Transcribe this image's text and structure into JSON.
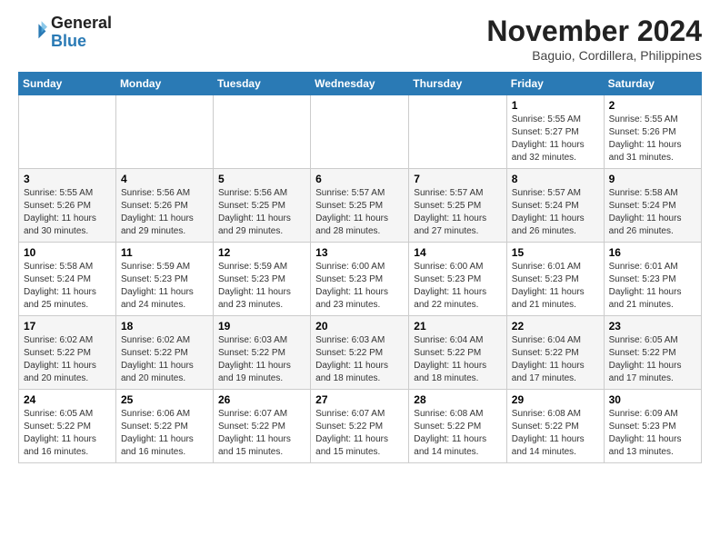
{
  "header": {
    "logo_line1": "General",
    "logo_line2": "Blue",
    "month": "November 2024",
    "location": "Baguio, Cordillera, Philippines"
  },
  "weekdays": [
    "Sunday",
    "Monday",
    "Tuesday",
    "Wednesday",
    "Thursday",
    "Friday",
    "Saturday"
  ],
  "weeks": [
    [
      {
        "day": "",
        "info": ""
      },
      {
        "day": "",
        "info": ""
      },
      {
        "day": "",
        "info": ""
      },
      {
        "day": "",
        "info": ""
      },
      {
        "day": "",
        "info": ""
      },
      {
        "day": "1",
        "info": "Sunrise: 5:55 AM\nSunset: 5:27 PM\nDaylight: 11 hours and 32 minutes."
      },
      {
        "day": "2",
        "info": "Sunrise: 5:55 AM\nSunset: 5:26 PM\nDaylight: 11 hours and 31 minutes."
      }
    ],
    [
      {
        "day": "3",
        "info": "Sunrise: 5:55 AM\nSunset: 5:26 PM\nDaylight: 11 hours and 30 minutes."
      },
      {
        "day": "4",
        "info": "Sunrise: 5:56 AM\nSunset: 5:26 PM\nDaylight: 11 hours and 29 minutes."
      },
      {
        "day": "5",
        "info": "Sunrise: 5:56 AM\nSunset: 5:25 PM\nDaylight: 11 hours and 29 minutes."
      },
      {
        "day": "6",
        "info": "Sunrise: 5:57 AM\nSunset: 5:25 PM\nDaylight: 11 hours and 28 minutes."
      },
      {
        "day": "7",
        "info": "Sunrise: 5:57 AM\nSunset: 5:25 PM\nDaylight: 11 hours and 27 minutes."
      },
      {
        "day": "8",
        "info": "Sunrise: 5:57 AM\nSunset: 5:24 PM\nDaylight: 11 hours and 26 minutes."
      },
      {
        "day": "9",
        "info": "Sunrise: 5:58 AM\nSunset: 5:24 PM\nDaylight: 11 hours and 26 minutes."
      }
    ],
    [
      {
        "day": "10",
        "info": "Sunrise: 5:58 AM\nSunset: 5:24 PM\nDaylight: 11 hours and 25 minutes."
      },
      {
        "day": "11",
        "info": "Sunrise: 5:59 AM\nSunset: 5:23 PM\nDaylight: 11 hours and 24 minutes."
      },
      {
        "day": "12",
        "info": "Sunrise: 5:59 AM\nSunset: 5:23 PM\nDaylight: 11 hours and 23 minutes."
      },
      {
        "day": "13",
        "info": "Sunrise: 6:00 AM\nSunset: 5:23 PM\nDaylight: 11 hours and 23 minutes."
      },
      {
        "day": "14",
        "info": "Sunrise: 6:00 AM\nSunset: 5:23 PM\nDaylight: 11 hours and 22 minutes."
      },
      {
        "day": "15",
        "info": "Sunrise: 6:01 AM\nSunset: 5:23 PM\nDaylight: 11 hours and 21 minutes."
      },
      {
        "day": "16",
        "info": "Sunrise: 6:01 AM\nSunset: 5:23 PM\nDaylight: 11 hours and 21 minutes."
      }
    ],
    [
      {
        "day": "17",
        "info": "Sunrise: 6:02 AM\nSunset: 5:22 PM\nDaylight: 11 hours and 20 minutes."
      },
      {
        "day": "18",
        "info": "Sunrise: 6:02 AM\nSunset: 5:22 PM\nDaylight: 11 hours and 20 minutes."
      },
      {
        "day": "19",
        "info": "Sunrise: 6:03 AM\nSunset: 5:22 PM\nDaylight: 11 hours and 19 minutes."
      },
      {
        "day": "20",
        "info": "Sunrise: 6:03 AM\nSunset: 5:22 PM\nDaylight: 11 hours and 18 minutes."
      },
      {
        "day": "21",
        "info": "Sunrise: 6:04 AM\nSunset: 5:22 PM\nDaylight: 11 hours and 18 minutes."
      },
      {
        "day": "22",
        "info": "Sunrise: 6:04 AM\nSunset: 5:22 PM\nDaylight: 11 hours and 17 minutes."
      },
      {
        "day": "23",
        "info": "Sunrise: 6:05 AM\nSunset: 5:22 PM\nDaylight: 11 hours and 17 minutes."
      }
    ],
    [
      {
        "day": "24",
        "info": "Sunrise: 6:05 AM\nSunset: 5:22 PM\nDaylight: 11 hours and 16 minutes."
      },
      {
        "day": "25",
        "info": "Sunrise: 6:06 AM\nSunset: 5:22 PM\nDaylight: 11 hours and 16 minutes."
      },
      {
        "day": "26",
        "info": "Sunrise: 6:07 AM\nSunset: 5:22 PM\nDaylight: 11 hours and 15 minutes."
      },
      {
        "day": "27",
        "info": "Sunrise: 6:07 AM\nSunset: 5:22 PM\nDaylight: 11 hours and 15 minutes."
      },
      {
        "day": "28",
        "info": "Sunrise: 6:08 AM\nSunset: 5:22 PM\nDaylight: 11 hours and 14 minutes."
      },
      {
        "day": "29",
        "info": "Sunrise: 6:08 AM\nSunset: 5:22 PM\nDaylight: 11 hours and 14 minutes."
      },
      {
        "day": "30",
        "info": "Sunrise: 6:09 AM\nSunset: 5:23 PM\nDaylight: 11 hours and 13 minutes."
      }
    ]
  ]
}
